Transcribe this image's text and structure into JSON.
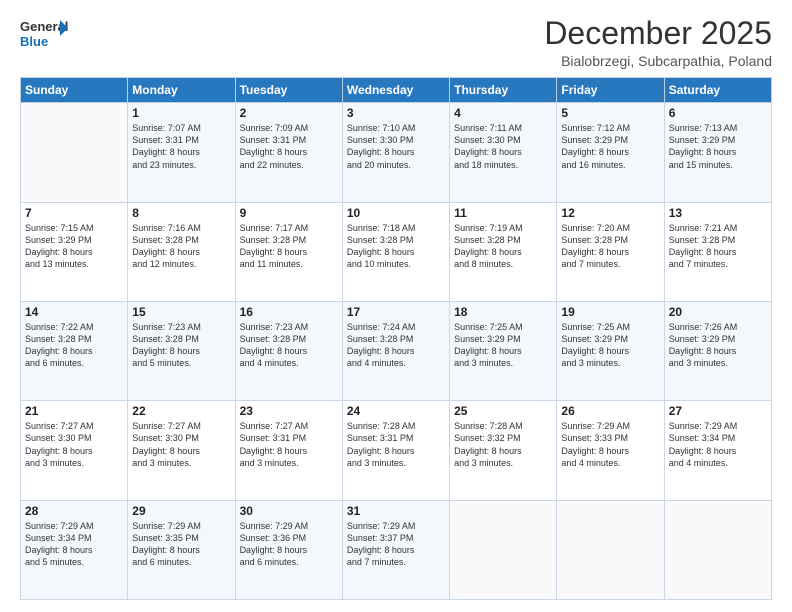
{
  "header": {
    "logo": {
      "general": "General",
      "blue": "Blue"
    },
    "title": "December 2025",
    "location": "Bialobrzegi, Subcarpathia, Poland"
  },
  "calendar": {
    "days_of_week": [
      "Sunday",
      "Monday",
      "Tuesday",
      "Wednesday",
      "Thursday",
      "Friday",
      "Saturday"
    ],
    "weeks": [
      [
        {
          "day": "",
          "info": ""
        },
        {
          "day": "1",
          "info": "Sunrise: 7:07 AM\nSunset: 3:31 PM\nDaylight: 8 hours\nand 23 minutes."
        },
        {
          "day": "2",
          "info": "Sunrise: 7:09 AM\nSunset: 3:31 PM\nDaylight: 8 hours\nand 22 minutes."
        },
        {
          "day": "3",
          "info": "Sunrise: 7:10 AM\nSunset: 3:30 PM\nDaylight: 8 hours\nand 20 minutes."
        },
        {
          "day": "4",
          "info": "Sunrise: 7:11 AM\nSunset: 3:30 PM\nDaylight: 8 hours\nand 18 minutes."
        },
        {
          "day": "5",
          "info": "Sunrise: 7:12 AM\nSunset: 3:29 PM\nDaylight: 8 hours\nand 16 minutes."
        },
        {
          "day": "6",
          "info": "Sunrise: 7:13 AM\nSunset: 3:29 PM\nDaylight: 8 hours\nand 15 minutes."
        }
      ],
      [
        {
          "day": "7",
          "info": "Sunrise: 7:15 AM\nSunset: 3:29 PM\nDaylight: 8 hours\nand 13 minutes."
        },
        {
          "day": "8",
          "info": "Sunrise: 7:16 AM\nSunset: 3:28 PM\nDaylight: 8 hours\nand 12 minutes."
        },
        {
          "day": "9",
          "info": "Sunrise: 7:17 AM\nSunset: 3:28 PM\nDaylight: 8 hours\nand 11 minutes."
        },
        {
          "day": "10",
          "info": "Sunrise: 7:18 AM\nSunset: 3:28 PM\nDaylight: 8 hours\nand 10 minutes."
        },
        {
          "day": "11",
          "info": "Sunrise: 7:19 AM\nSunset: 3:28 PM\nDaylight: 8 hours\nand 8 minutes."
        },
        {
          "day": "12",
          "info": "Sunrise: 7:20 AM\nSunset: 3:28 PM\nDaylight: 8 hours\nand 7 minutes."
        },
        {
          "day": "13",
          "info": "Sunrise: 7:21 AM\nSunset: 3:28 PM\nDaylight: 8 hours\nand 7 minutes."
        }
      ],
      [
        {
          "day": "14",
          "info": "Sunrise: 7:22 AM\nSunset: 3:28 PM\nDaylight: 8 hours\nand 6 minutes."
        },
        {
          "day": "15",
          "info": "Sunrise: 7:23 AM\nSunset: 3:28 PM\nDaylight: 8 hours\nand 5 minutes."
        },
        {
          "day": "16",
          "info": "Sunrise: 7:23 AM\nSunset: 3:28 PM\nDaylight: 8 hours\nand 4 minutes."
        },
        {
          "day": "17",
          "info": "Sunrise: 7:24 AM\nSunset: 3:28 PM\nDaylight: 8 hours\nand 4 minutes."
        },
        {
          "day": "18",
          "info": "Sunrise: 7:25 AM\nSunset: 3:29 PM\nDaylight: 8 hours\nand 3 minutes."
        },
        {
          "day": "19",
          "info": "Sunrise: 7:25 AM\nSunset: 3:29 PM\nDaylight: 8 hours\nand 3 minutes."
        },
        {
          "day": "20",
          "info": "Sunrise: 7:26 AM\nSunset: 3:29 PM\nDaylight: 8 hours\nand 3 minutes."
        }
      ],
      [
        {
          "day": "21",
          "info": "Sunrise: 7:27 AM\nSunset: 3:30 PM\nDaylight: 8 hours\nand 3 minutes."
        },
        {
          "day": "22",
          "info": "Sunrise: 7:27 AM\nSunset: 3:30 PM\nDaylight: 8 hours\nand 3 minutes."
        },
        {
          "day": "23",
          "info": "Sunrise: 7:27 AM\nSunset: 3:31 PM\nDaylight: 8 hours\nand 3 minutes."
        },
        {
          "day": "24",
          "info": "Sunrise: 7:28 AM\nSunset: 3:31 PM\nDaylight: 8 hours\nand 3 minutes."
        },
        {
          "day": "25",
          "info": "Sunrise: 7:28 AM\nSunset: 3:32 PM\nDaylight: 8 hours\nand 3 minutes."
        },
        {
          "day": "26",
          "info": "Sunrise: 7:29 AM\nSunset: 3:33 PM\nDaylight: 8 hours\nand 4 minutes."
        },
        {
          "day": "27",
          "info": "Sunrise: 7:29 AM\nSunset: 3:34 PM\nDaylight: 8 hours\nand 4 minutes."
        }
      ],
      [
        {
          "day": "28",
          "info": "Sunrise: 7:29 AM\nSunset: 3:34 PM\nDaylight: 8 hours\nand 5 minutes."
        },
        {
          "day": "29",
          "info": "Sunrise: 7:29 AM\nSunset: 3:35 PM\nDaylight: 8 hours\nand 6 minutes."
        },
        {
          "day": "30",
          "info": "Sunrise: 7:29 AM\nSunset: 3:36 PM\nDaylight: 8 hours\nand 6 minutes."
        },
        {
          "day": "31",
          "info": "Sunrise: 7:29 AM\nSunset: 3:37 PM\nDaylight: 8 hours\nand 7 minutes."
        },
        {
          "day": "",
          "info": ""
        },
        {
          "day": "",
          "info": ""
        },
        {
          "day": "",
          "info": ""
        }
      ]
    ]
  }
}
